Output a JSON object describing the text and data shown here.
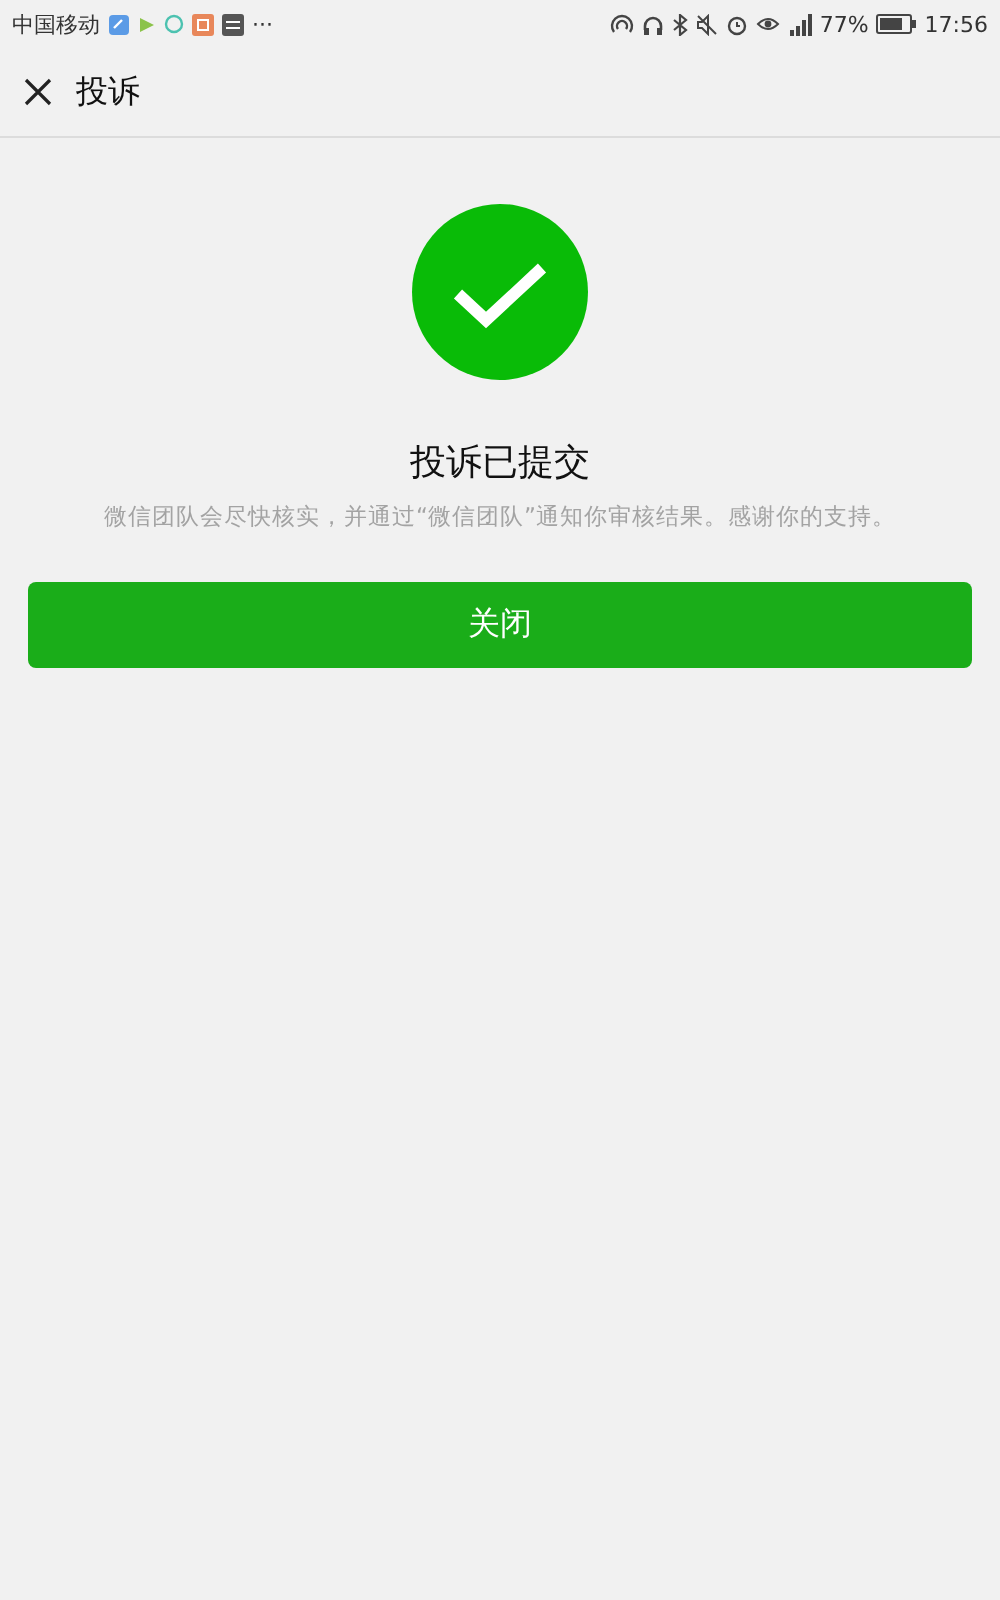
{
  "status_bar": {
    "carrier": "中国移动",
    "more": "···",
    "battery": "77%",
    "time": "17:56"
  },
  "nav": {
    "title": "投诉"
  },
  "result": {
    "title": "投诉已提交",
    "message": "微信团队会尽快核实，并通过“微信团队”通知你审核结果。感谢你的支持。"
  },
  "buttons": [
    "关闭"
  ]
}
